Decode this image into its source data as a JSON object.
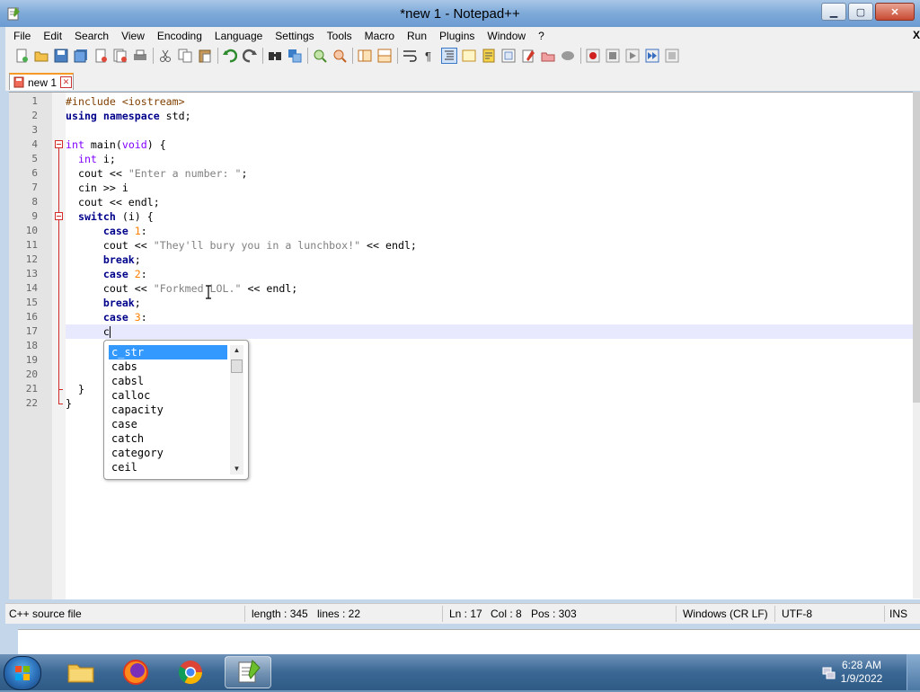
{
  "window": {
    "title": "*new 1 - Notepad++",
    "minimize_label": "▁",
    "maximize_label": "▢",
    "close_label": "✕"
  },
  "menu": {
    "items": [
      "File",
      "Edit",
      "Search",
      "View",
      "Encoding",
      "Language",
      "Settings",
      "Tools",
      "Macro",
      "Run",
      "Plugins",
      "Window",
      "?"
    ],
    "right_close": "X"
  },
  "toolbar": {
    "icons": [
      "new-file-icon",
      "open-file-icon",
      "save-icon",
      "save-all-icon",
      "close-icon",
      "close-all-icon",
      "print-icon",
      "cut-icon",
      "copy-icon",
      "paste-icon",
      "undo-icon",
      "redo-icon",
      "find-icon",
      "replace-icon",
      "zoom-in-icon",
      "zoom-out-icon",
      "sync-vertical-icon",
      "sync-horizontal-icon",
      "word-wrap-icon",
      "show-all-chars-icon",
      "indent-guide-icon",
      "udl-icon",
      "doc-map-icon",
      "function-list-icon",
      "folder-workspace-icon",
      "monitor-icon",
      "record-macro-icon",
      "stop-record-icon",
      "playback-icon",
      "run-macro-multiple-icon",
      "save-macro-icon"
    ]
  },
  "tab": {
    "label": "new 1",
    "close_glyph": "✕"
  },
  "editor": {
    "lines": [
      {
        "n": "1",
        "text": "#include <iostream>"
      },
      {
        "n": "2",
        "text": "using namespace std;"
      },
      {
        "n": "3",
        "text": ""
      },
      {
        "n": "4",
        "text": "int main(void) {"
      },
      {
        "n": "5",
        "text": "  int i;"
      },
      {
        "n": "6",
        "text": "  cout << \"Enter a number: \";"
      },
      {
        "n": "7",
        "text": "  cin >> i"
      },
      {
        "n": "8",
        "text": "  cout << endl;"
      },
      {
        "n": "9",
        "text": "  switch (i) {"
      },
      {
        "n": "10",
        "text": "      case 1:"
      },
      {
        "n": "11",
        "text": "      cout << \"They'll bury you in a lunchbox!\" << endl;"
      },
      {
        "n": "12",
        "text": "      break;"
      },
      {
        "n": "13",
        "text": "      case 2:"
      },
      {
        "n": "14",
        "text": "      cout << \"Forkmed LOL.\" << endl;"
      },
      {
        "n": "15",
        "text": "      break;"
      },
      {
        "n": "16",
        "text": "      case 3:"
      },
      {
        "n": "17",
        "text": "      c"
      },
      {
        "n": "18",
        "text": ""
      },
      {
        "n": "19",
        "text": ""
      },
      {
        "n": "20",
        "text": ""
      },
      {
        "n": "21",
        "text": "  }"
      },
      {
        "n": "22",
        "text": "}"
      }
    ],
    "current_line": 17
  },
  "autocomplete": {
    "items": [
      "c_str",
      "cabs",
      "cabsl",
      "calloc",
      "capacity",
      "case",
      "catch",
      "category",
      "ceil"
    ],
    "selected": 0
  },
  "status": {
    "file_type": "C++ source file",
    "length": "length : 345",
    "lines": "lines : 22",
    "ln": "Ln : 17",
    "col": "Col : 8",
    "pos": "Pos : 303",
    "eol": "Windows (CR LF)",
    "encoding": "UTF-8",
    "mode": "INS"
  },
  "taskbar": {
    "apps": [
      "file-explorer-icon",
      "firefox-icon",
      "chrome-icon",
      "notepadpp-icon"
    ],
    "time": "6:28 AM",
    "date": "1/9/2022"
  }
}
